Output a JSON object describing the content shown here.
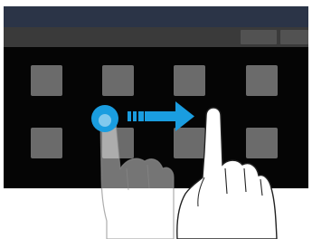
{
  "screen": {
    "app_grid": {
      "rows": 2,
      "columns": 4,
      "tiles": [
        "app-1",
        "app-2",
        "app-3",
        "app-4",
        "app-5",
        "app-6",
        "app-7",
        "app-8"
      ]
    }
  },
  "gesture": {
    "type": "swipe",
    "direction": "right",
    "start_marker": "touch-point-icon",
    "arrow": "arrow-right-icon",
    "hands": [
      "ghost-hand-icon",
      "hand-icon"
    ]
  },
  "colors": {
    "status_bar": "#2b3447",
    "action_bar": "#3a3a3a",
    "grid_background": "#050505",
    "tile": "#6b6b6b",
    "gesture_accent": "#1a9de0"
  }
}
